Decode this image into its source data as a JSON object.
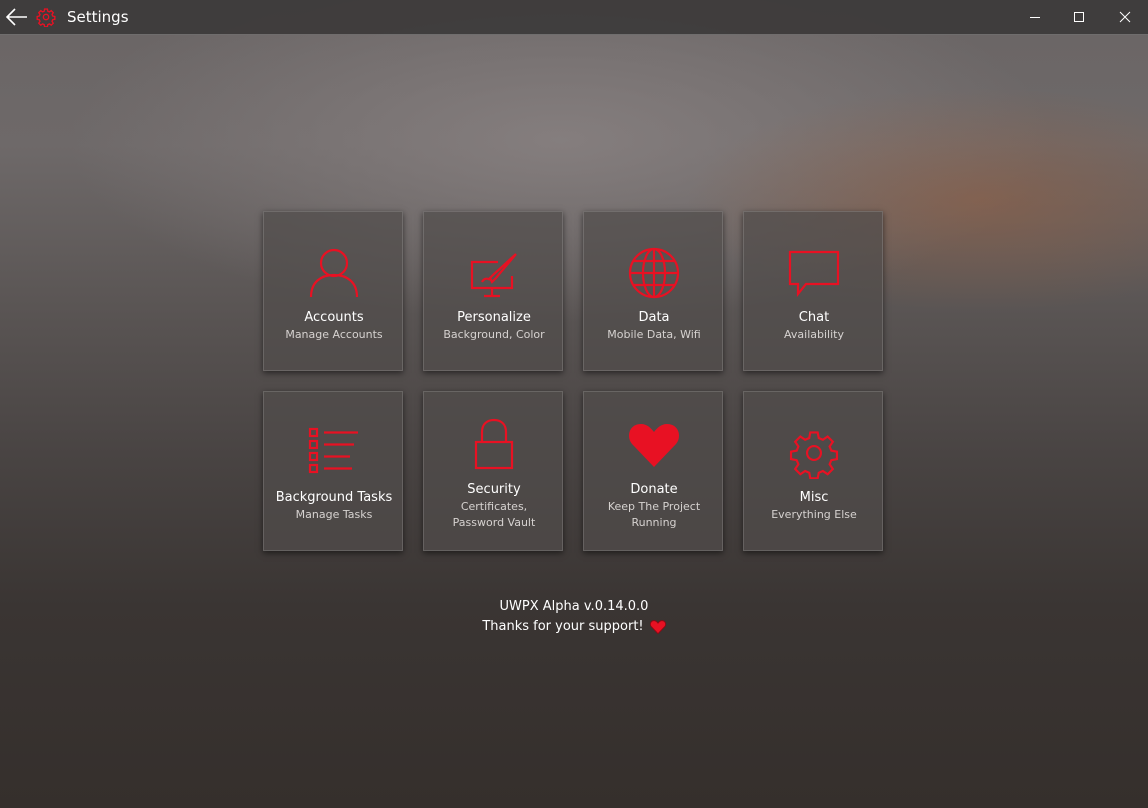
{
  "window": {
    "title": "Settings",
    "accent_color": "#e81123"
  },
  "titlebar": {
    "back_icon": "back-arrow-icon",
    "app_icon": "gear-icon",
    "controls": [
      "minimize-icon",
      "maximize-icon",
      "close-icon"
    ]
  },
  "tiles": [
    {
      "label": "Accounts",
      "sub": "Manage Accounts",
      "icon": "person-icon"
    },
    {
      "label": "Personalize",
      "sub": "Background, Color",
      "icon": "paintbrush-monitor-icon"
    },
    {
      "label": "Data",
      "sub": "Mobile Data, Wifi",
      "icon": "globe-icon"
    },
    {
      "label": "Chat",
      "sub": "Availability",
      "icon": "chat-bubble-icon"
    },
    {
      "label": "Background Tasks",
      "sub": "Manage Tasks",
      "icon": "checklist-icon"
    },
    {
      "label": "Security",
      "sub": "Certificates,",
      "sub2": "Password Vault",
      "icon": "lock-icon"
    },
    {
      "label": "Donate",
      "sub": "Keep The Project",
      "sub2": "Running",
      "icon": "heart-icon"
    },
    {
      "label": "Misc",
      "sub": "Everything Else",
      "icon": "gear-icon"
    }
  ],
  "footer": {
    "version": "UWPX Alpha v.0.14.0.0",
    "thanks": "Thanks for your support!",
    "thanks_icon": "heart-icon"
  }
}
